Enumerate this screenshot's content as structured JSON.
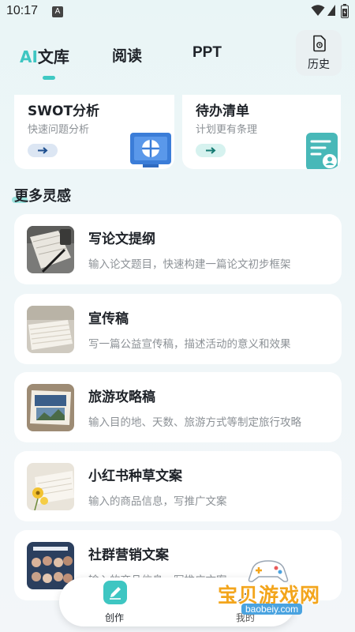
{
  "status_bar": {
    "time": "10:17",
    "notification_glyph": "A"
  },
  "tabs": [
    {
      "ai_label": "AI",
      "label": "文库"
    },
    {
      "label": "阅读"
    },
    {
      "label": "PPT"
    }
  ],
  "history": {
    "label": "历史",
    "icon": "document-clock-icon"
  },
  "feature_cards": [
    {
      "title": "SWOT分析",
      "subtitle": "快速问题分析",
      "arrow": "→",
      "icon": "monitor-grid-icon"
    },
    {
      "title": "待办清单",
      "subtitle": "计划更有条理",
      "arrow": "→",
      "icon": "checklist-doc-icon"
    }
  ],
  "section": {
    "title": "更多灵感"
  },
  "list": [
    {
      "title": "写论文提纲",
      "description": "输入论文题目，快速构建一篇论文初步框架",
      "thumb": "notebook-pen-photo"
    },
    {
      "title": "宣传稿",
      "description": "写一篇公益宣传稿，描述活动的意义和效果",
      "thumb": "paper-stack-photo"
    },
    {
      "title": "旅游攻略稿",
      "description": "输入目的地、天数、旅游方式等制定旅行攻略",
      "thumb": "travel-guide-book-photo"
    },
    {
      "title": "小红书种草文案",
      "description": "输入的商品信息，写推广文案",
      "thumb": "flower-book-photo"
    },
    {
      "title": "社群营销文案",
      "description": "输入的商品信息，写推广文案",
      "thumb": "community-avatars-photo"
    }
  ],
  "bottom_nav": [
    {
      "label": "创作",
      "icon": "pencil-icon"
    },
    {
      "label": "我的",
      "icon": "user-icon"
    }
  ],
  "watermark": {
    "text": "宝贝游戏网",
    "url": "baobeiy.com"
  },
  "colors": {
    "accent": "#3ec6c2",
    "brand_blue": "#3b7dd8"
  }
}
